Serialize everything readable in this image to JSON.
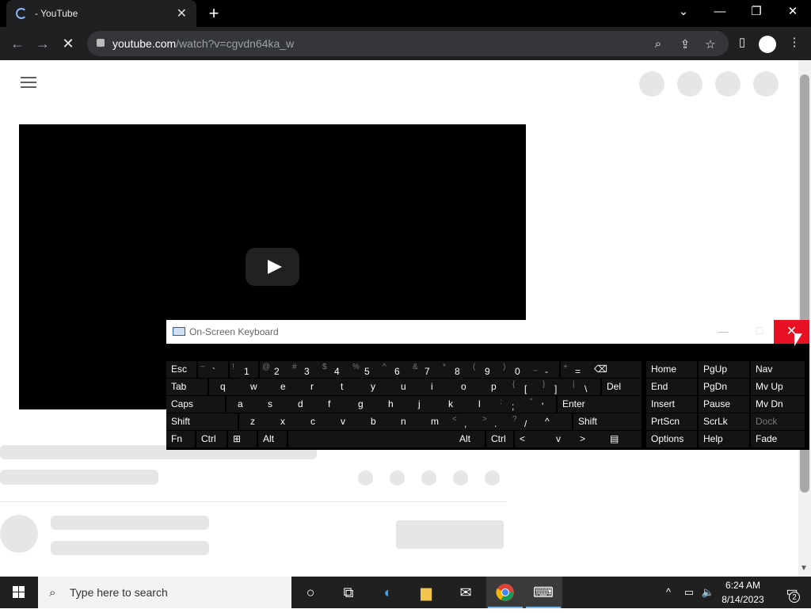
{
  "browser": {
    "tab_title": "- YouTube",
    "url_domain": "youtube.com",
    "url_path": "/watch?v=cgvdn64ka_w"
  },
  "osk": {
    "title": "On-Screen Keyboard",
    "rows": [
      [
        [
          "Esc"
        ],
        [
          "~",
          "`"
        ],
        [
          "!",
          "1"
        ],
        [
          "@",
          "2"
        ],
        [
          "#",
          "3"
        ],
        [
          "$",
          "4"
        ],
        [
          "%",
          "5"
        ],
        [
          "^",
          "6"
        ],
        [
          "&",
          "7"
        ],
        [
          "*",
          "8"
        ],
        [
          "(",
          "9"
        ],
        [
          ")",
          "0"
        ],
        [
          "_",
          "-"
        ],
        [
          "+",
          "="
        ],
        [
          "⌫"
        ]
      ],
      [
        [
          "Tab"
        ],
        [
          "q"
        ],
        [
          "w"
        ],
        [
          "e"
        ],
        [
          "r"
        ],
        [
          "t"
        ],
        [
          "y"
        ],
        [
          "u"
        ],
        [
          "i"
        ],
        [
          "o"
        ],
        [
          "p"
        ],
        [
          "{",
          "["
        ],
        [
          "}",
          "]"
        ],
        [
          "|",
          "\\"
        ],
        [
          "Del"
        ]
      ],
      [
        [
          "Caps"
        ],
        [
          "a"
        ],
        [
          "s"
        ],
        [
          "d"
        ],
        [
          "f"
        ],
        [
          "g"
        ],
        [
          "h"
        ],
        [
          "j"
        ],
        [
          "k"
        ],
        [
          "l"
        ],
        [
          ":",
          ";"
        ],
        [
          "\"",
          "'"
        ],
        [
          "Enter"
        ]
      ],
      [
        [
          "Shift"
        ],
        [
          "z"
        ],
        [
          "x"
        ],
        [
          "c"
        ],
        [
          "v"
        ],
        [
          "b"
        ],
        [
          "n"
        ],
        [
          "m"
        ],
        [
          "<",
          ","
        ],
        [
          ">",
          "."
        ],
        [
          "?",
          "/"
        ],
        [
          "^"
        ],
        [
          "Shift"
        ]
      ],
      [
        [
          "Fn"
        ],
        [
          "Ctrl"
        ],
        [
          "⊞"
        ],
        [
          "Alt"
        ],
        [
          ""
        ],
        [
          "Alt"
        ],
        [
          "Ctrl"
        ],
        [
          "<"
        ],
        [
          "v"
        ],
        [
          ">"
        ],
        [
          "▤"
        ]
      ]
    ],
    "nav_keys": [
      [
        "Home",
        "PgUp",
        "Nav"
      ],
      [
        "End",
        "PgDn",
        "Mv Up"
      ],
      [
        "Insert",
        "Pause",
        "Mv Dn"
      ],
      [
        "PrtScn",
        "ScrLk",
        "Dock"
      ],
      [
        "Options",
        "Help",
        "Fade"
      ]
    ]
  },
  "taskbar": {
    "search_placeholder": "Type here to search",
    "time": "6:24 AM",
    "date": "8/14/2023",
    "notifications": "2"
  }
}
